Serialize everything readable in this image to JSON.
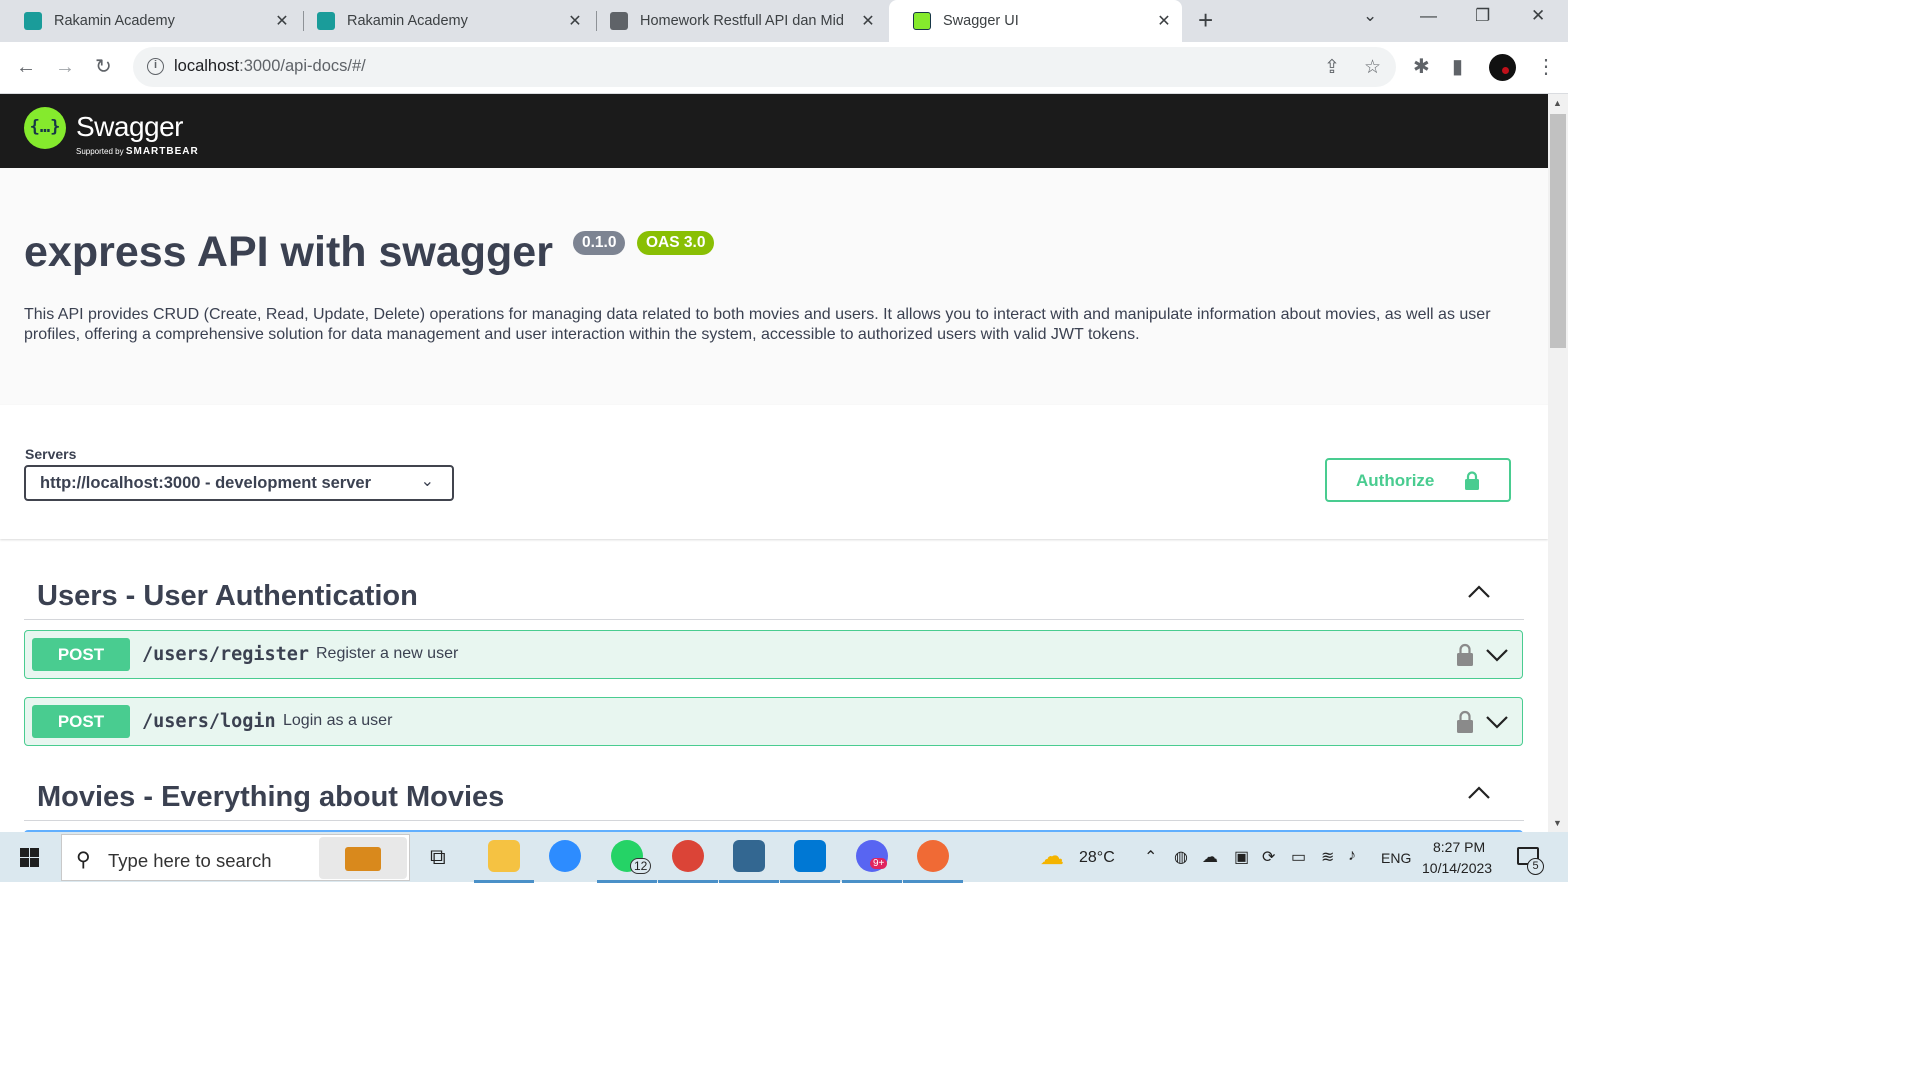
{
  "browser": {
    "tabs": [
      {
        "title": "Rakamin Academy",
        "icon": "rakamin-icon"
      },
      {
        "title": "Rakamin Academy",
        "icon": "rakamin-icon"
      },
      {
        "title": "Homework Restfull API dan Mid",
        "icon": "globe-icon"
      },
      {
        "title": "Swagger UI",
        "icon": "swagger-icon",
        "active": true
      }
    ],
    "url_host": "localhost",
    "url_rest": ":3000/api-docs/#/"
  },
  "swagger": {
    "brand": "Swagger",
    "supported_by": "Supported by",
    "smartbear": "SMARTBEAR",
    "brand_color": "#85ea2d"
  },
  "info": {
    "title": "express API with swagger",
    "version": "0.1.0",
    "oas": "OAS 3.0",
    "description": "This API provides CRUD (Create, Read, Update, Delete) operations for managing data related to both movies and users. It allows you to interact with and manipulate information about movies, as well as user profiles, offering a comprehensive solution for data management and user interaction within the system, accessible to authorized users with valid JWT tokens."
  },
  "servers": {
    "label": "Servers",
    "selected": "http://localhost:3000 - development server"
  },
  "authorize_label": "Authorize",
  "tags": [
    {
      "name": "Users - User Authentication",
      "operations": [
        {
          "method": "POST",
          "path": "/users/register",
          "summary": "Register a new user"
        },
        {
          "method": "POST",
          "path": "/users/login",
          "summary": "Login as a user"
        }
      ]
    },
    {
      "name": "Movies - Everything about Movies",
      "operations": []
    }
  ],
  "taskbar": {
    "search_placeholder": "Type here to search",
    "whatsapp_badge": "12",
    "discord_badge": "9+",
    "temperature": "28°C",
    "language": "ENG",
    "time": "8:27 PM",
    "date": "10/14/2023",
    "notifications": "5"
  }
}
